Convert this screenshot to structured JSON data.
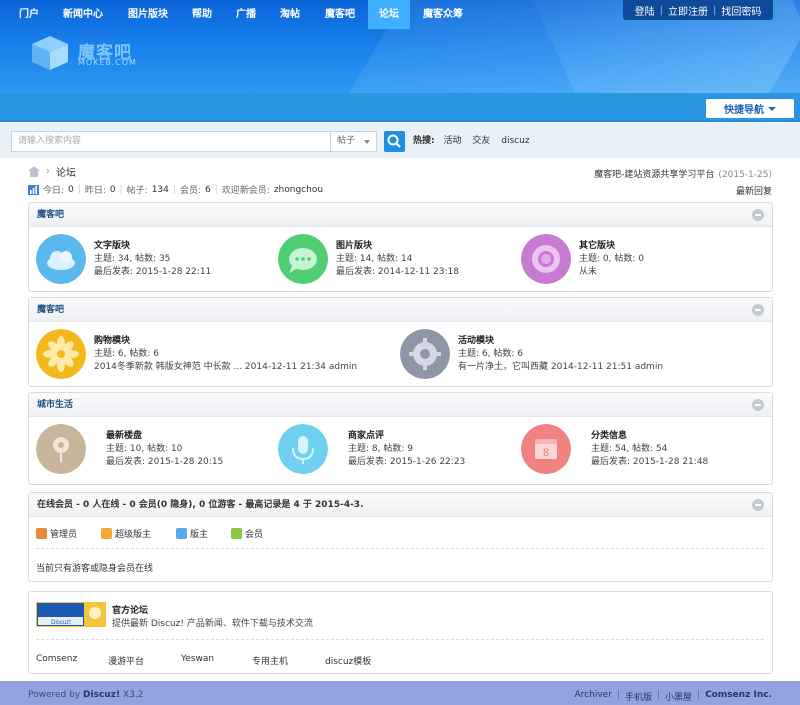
{
  "header": {
    "logo_text": "魔客吧",
    "logo_sub": "MOKE8.COM",
    "toplinks": [
      "登陆",
      "立即注册",
      "找回密码"
    ]
  },
  "nav": {
    "items": [
      "门户",
      "新闻中心",
      "图片版块",
      "帮助",
      "广播",
      "淘帖",
      "魔客吧",
      "论坛",
      "魔客众筹"
    ],
    "active": "论坛",
    "quicknav": "快捷导航"
  },
  "search": {
    "placeholder": "请输入搜索内容",
    "type": "帖子",
    "hot_label": "热搜:",
    "hot_words": [
      "活动",
      "交友",
      "discuz"
    ]
  },
  "breadcrumb": {
    "current": "论坛"
  },
  "site_tag": {
    "text": "魔客吧-建站资源共享学习平台",
    "date": "(2015-1-25)"
  },
  "stats": {
    "today_label": "今日:",
    "today": "0",
    "yesterday_label": "昨日:",
    "yesterday": "0",
    "posts_label": "帖子:",
    "posts": "134",
    "members_label": "会员:",
    "members": "6",
    "welcome_label": "欢迎新会员:",
    "newest": "zhongchou",
    "latest_reply": "最新回复"
  },
  "groups": [
    {
      "title": "魔客吧",
      "forums": [
        {
          "name": "文字版块",
          "line1": "主题: 34, 帖数: 35",
          "line2": "最后发表: 2015-1-28 22:11",
          "color": "#5ab8ef"
        },
        {
          "name": "图片版块",
          "line1": "主题: 14, 帖数: 14",
          "line2": "最后发表: 2014-12-11 23:18",
          "color": "#4fcf72"
        },
        {
          "name": "其它版块",
          "line1": "主题: 0, 帖数: 0",
          "line2": "从未",
          "color": "#c77bd1"
        }
      ]
    },
    {
      "title": "魔客吧",
      "forums": [
        {
          "name": "购物模块",
          "line1": "主题: 6, 帖数: 6",
          "line2": "2014冬季新款 韩版女神范 中长款 ... 2014-12-11 21:34 admin",
          "color": "#f2b81c"
        },
        {
          "name": "活动模块",
          "line1": "主题: 6, 帖数: 6",
          "line2": "有一片净土，它叫西藏 2014-12-11 21:51 admin",
          "color": "#8f96a8"
        }
      ]
    },
    {
      "title": "城市生活",
      "forums": [
        {
          "name": "最新楼盘",
          "line1": "主题: 10, 帖数: 10",
          "line2": "最后发表: 2015-1-28 20:15",
          "color": "#c9b59c"
        },
        {
          "name": "商家点评",
          "line1": "主题: 8, 帖数: 9",
          "line2": "最后发表: 2015-1-26 22:23",
          "color": "#6fd0f0"
        },
        {
          "name": "分类信息",
          "line1": "主题: 54, 帖数: 54",
          "line2": "最后发表: 2015-1-28 21:48",
          "color": "#f08282"
        }
      ]
    }
  ],
  "online": {
    "title": "在线会员 - 0 人在线 - 0 会员(0 隐身), 0 位游客 - 最高记录是 4 于 2015-4-3.",
    "legend": [
      {
        "label": "管理员",
        "color": "#e88a3a"
      },
      {
        "label": "超级版主",
        "color": "#f0a93a"
      },
      {
        "label": "版主",
        "color": "#5aa8e8"
      },
      {
        "label": "会员",
        "color": "#8dc63f"
      }
    ],
    "note": "当前只有游客或隐身会员在线"
  },
  "official": {
    "badge": "Discuz!",
    "title": "官方论坛",
    "desc": "提供最新 Discuz! 产品新闻、软件下载与技术交流",
    "links": [
      "Comsenz",
      "漫游平台",
      "Yeswan",
      "专用主机",
      "discuz模板"
    ]
  },
  "footer": {
    "powered": "Powered by",
    "brand": "Discuz!",
    "version": "X3.2",
    "links": [
      "Archiver",
      "手机版",
      "小黑屋",
      "Comsenz Inc."
    ]
  }
}
